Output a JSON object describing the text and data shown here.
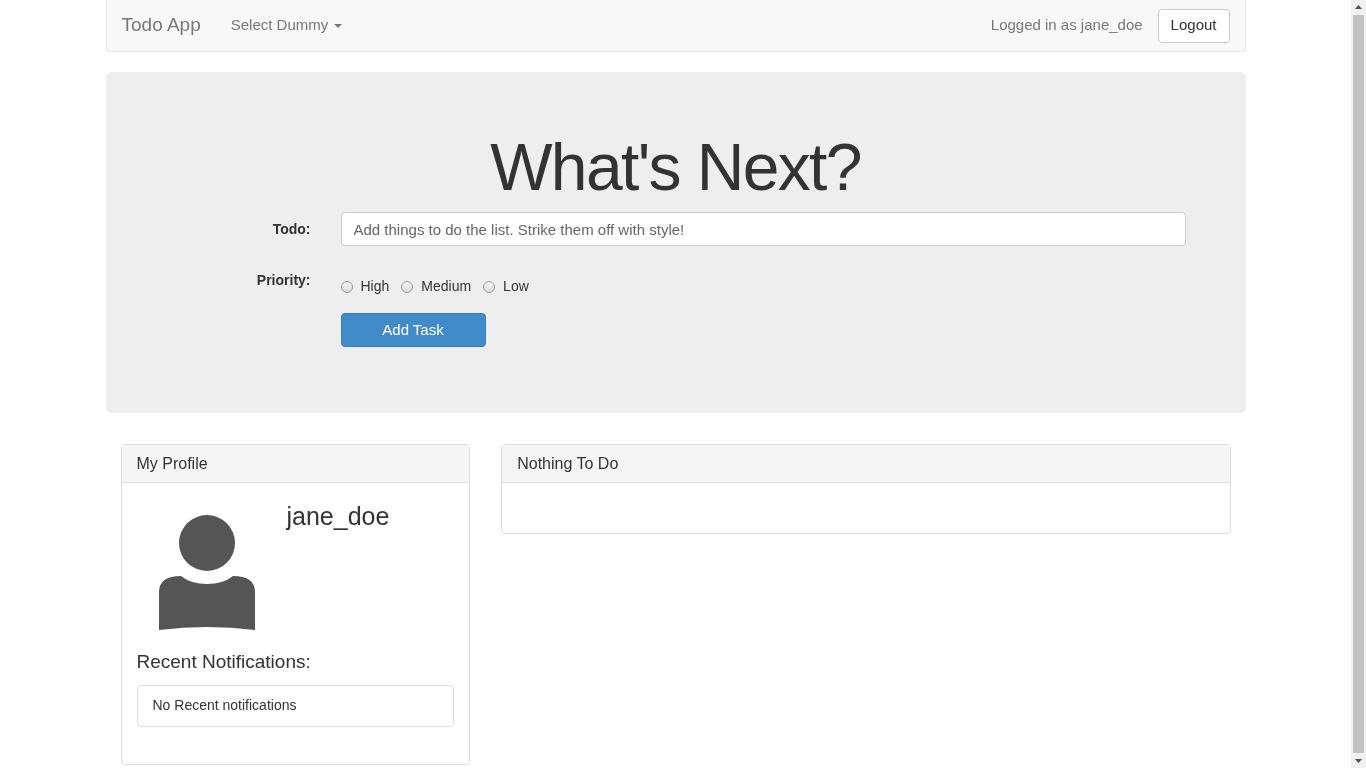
{
  "navbar": {
    "brand": "Todo App",
    "dropdown": {
      "label": "Select Dummy"
    },
    "user_text": "Logged in as jane_doe",
    "logout_button": "Logout"
  },
  "hero": {
    "title": "What's Next?",
    "todo_label": "Todo:",
    "todo_field": {
      "placeholder": "Add things to do the list. Strike them off with style!"
    },
    "priority_label": "Priority:",
    "priorities": [
      {
        "label": "High",
        "selected": false
      },
      {
        "label": "Medium",
        "selected": false
      },
      {
        "label": "Low",
        "selected": false
      }
    ],
    "add_button": "Add Task"
  },
  "profile": {
    "title": "My Profile",
    "username": "jane_doe",
    "notifications_heading": "Recent Notifications:",
    "notifications": [
      "No Recent notifications"
    ]
  },
  "todo_panel": {
    "title": "Nothing To Do"
  }
}
